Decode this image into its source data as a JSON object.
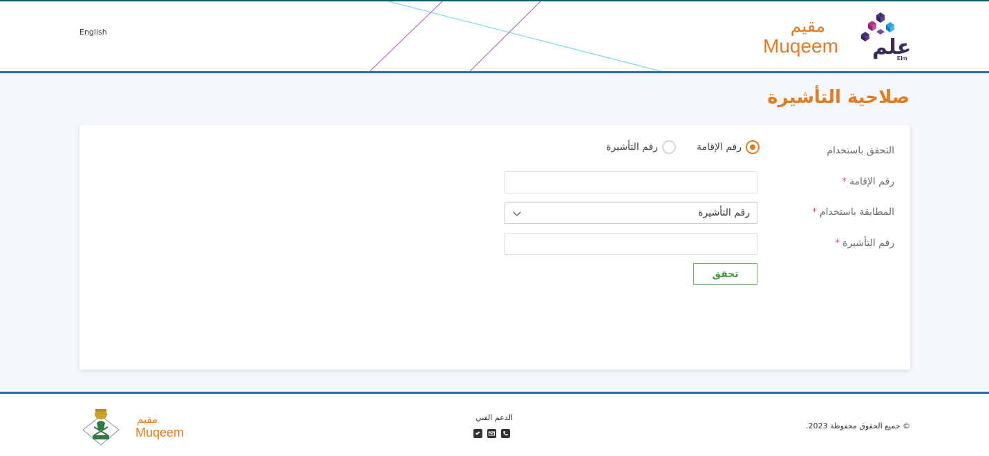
{
  "header": {
    "language_link": "English",
    "muqeem_logo_ar": "مقيم",
    "muqeem_logo_en": "Muqeem",
    "elm_logo_ar": "علم",
    "elm_logo_en": "Elm"
  },
  "page": {
    "title": "صلاحية التأشيرة"
  },
  "form": {
    "verify_using_label": "التحقق باستخدام",
    "radio_options": [
      {
        "label": "رقم الإقامة",
        "selected": true
      },
      {
        "label": "رقم التأشيرة",
        "selected": false
      }
    ],
    "iqama_number_label": "رقم الإقامة",
    "iqama_number_value": "",
    "match_using_label": "المطابقة باستخدام",
    "match_using_selected": "رقم التأشيرة",
    "visa_number_label": "رقم التأشيرة",
    "visa_number_value": "",
    "required_marker": "*",
    "verify_button": "تحقق"
  },
  "footer": {
    "copyright": "© جميع الحقوق محفوظة 2023.",
    "support_label": "الدعم الفني",
    "support_icons": [
      "twitter-icon",
      "email-icon",
      "phone-icon"
    ],
    "muqeem_ar": "مقيم",
    "muqeem_en": "Muqeem"
  },
  "colors": {
    "accent": "#e67a21",
    "header_border": "#2e6da9",
    "button_green": "#5cb85c"
  }
}
